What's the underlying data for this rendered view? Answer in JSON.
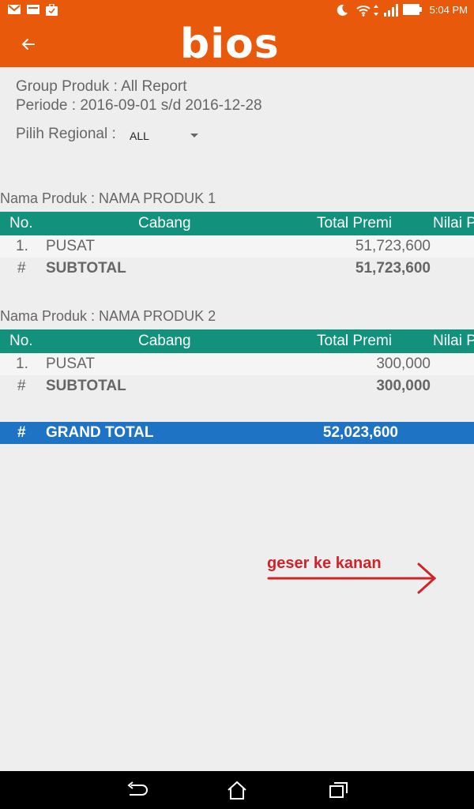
{
  "status_bar": {
    "time": "5:04 PM",
    "left_icons": [
      "gmail-icon",
      "mail-icon",
      "briefcase-icon"
    ],
    "right_icons": [
      "moon-icon",
      "wifi-icon",
      "data-arrows-icon",
      "signal-icon",
      "battery-icon"
    ]
  },
  "app_bar": {
    "logo_text": "bios",
    "back_icon": "back-arrow-icon"
  },
  "report": {
    "group_produk": "Group Produk : All Report",
    "periode": "Periode : 2016-09-01 s/d 2016-12-28"
  },
  "filter": {
    "label": "Pilih Regional :",
    "selected": "ALL"
  },
  "table_headers": {
    "no": "No.",
    "cabang": "Cabang",
    "total_premi": "Total Premi",
    "nilai": "Nilai P"
  },
  "products": [
    {
      "title": "Nama Produk : NAMA PRODUK 1",
      "rows": [
        {
          "no": "1.",
          "cabang": "PUSAT",
          "total_premi": "51,723,600"
        }
      ],
      "subtotal": {
        "mark": "#",
        "label": "SUBTOTAL",
        "total_premi": "51,723,600"
      }
    },
    {
      "title": "Nama Produk : NAMA PRODUK 2",
      "rows": [
        {
          "no": "1.",
          "cabang": "PUSAT",
          "total_premi": "300,000"
        }
      ],
      "subtotal": {
        "mark": "#",
        "label": "SUBTOTAL",
        "total_premi": "300,000"
      }
    }
  ],
  "grand_total": {
    "mark": "#",
    "label": "GRAND TOTAL",
    "value": "52,023,600"
  },
  "hint": {
    "text": "geser ke kanan",
    "color": "#d0232a"
  },
  "nav_bar": [
    "back-nav-icon",
    "home-icon",
    "recent-apps-icon"
  ],
  "colors": {
    "brand_orange": "#e8590c",
    "table_header": "#12917d",
    "grand_total": "#1e73c4"
  }
}
